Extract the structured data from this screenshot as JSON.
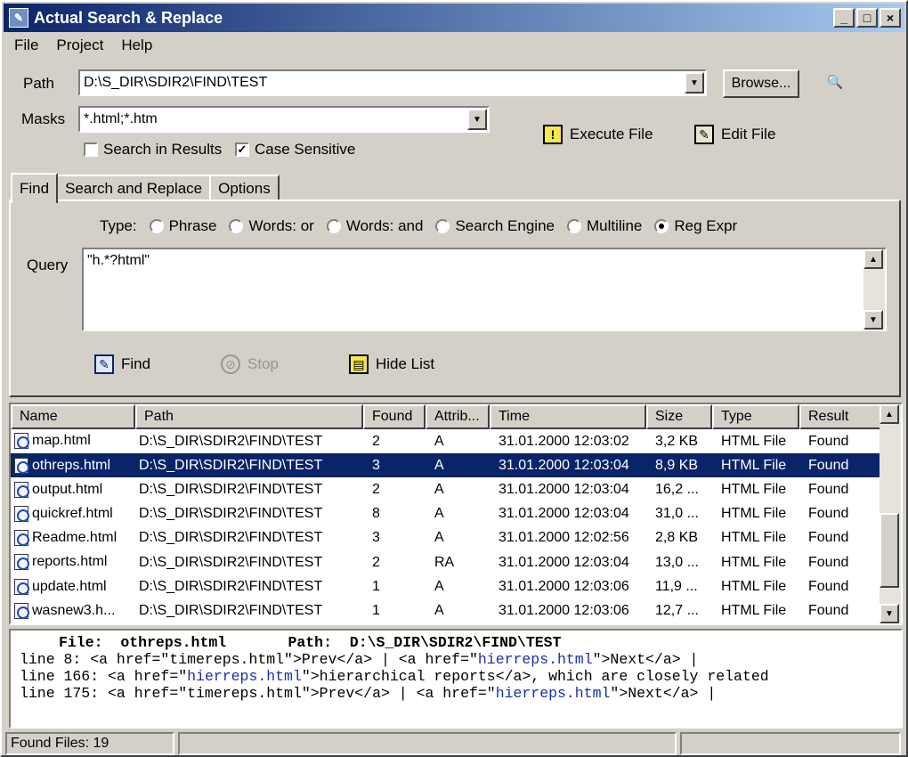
{
  "window": {
    "title": "Actual Search & Replace",
    "minimize": "_",
    "maximize": "□",
    "close": "×"
  },
  "menu": [
    "File",
    "Project",
    "Help"
  ],
  "path": {
    "label": "Path",
    "value": "D:\\S_DIR\\SDIR2\\FIND\\TEST",
    "browse_label": "Browse..."
  },
  "masks": {
    "label": "Masks",
    "value": "*.html;*.htm"
  },
  "options": {
    "search_in_results": "Search in Results",
    "search_in_results_checked": false,
    "case_sensitive": "Case Sensitive",
    "case_sensitive_checked": true
  },
  "actions": {
    "execute_file": "Execute File",
    "edit_file": "Edit File"
  },
  "tabs": [
    {
      "label": "Find",
      "active": true
    },
    {
      "label": "Search and Replace",
      "active": false
    },
    {
      "label": "Options",
      "active": false
    }
  ],
  "find": {
    "type_label": "Type:",
    "types": [
      {
        "label": "Phrase",
        "selected": false
      },
      {
        "label": "Words: or",
        "selected": false
      },
      {
        "label": "Words: and",
        "selected": false
      },
      {
        "label": "Search Engine",
        "selected": false
      },
      {
        "label": "Multiline",
        "selected": false
      },
      {
        "label": "Reg Expr",
        "selected": true
      }
    ],
    "query_label": "Query",
    "query": "\"h.*?html\"",
    "find_label": "Find",
    "stop_label": "Stop",
    "hide_list_label": "Hide List"
  },
  "table": {
    "columns": [
      "Name",
      "Path",
      "Found",
      "Attrib...",
      "Time",
      "Size",
      "Type",
      "Result"
    ],
    "rows": [
      [
        "map.html",
        "D:\\S_DIR\\SDIR2\\FIND\\TEST",
        "2",
        "A",
        "31.01.2000 12:03:02",
        "3,2 KB",
        "HTML File",
        "Found"
      ],
      [
        "othreps.html",
        "D:\\S_DIR\\SDIR2\\FIND\\TEST",
        "3",
        "A",
        "31.01.2000 12:03:04",
        "8,9 KB",
        "HTML File",
        "Found"
      ],
      [
        "output.html",
        "D:\\S_DIR\\SDIR2\\FIND\\TEST",
        "2",
        "A",
        "31.01.2000 12:03:04",
        "16,2 ...",
        "HTML File",
        "Found"
      ],
      [
        "quickref.html",
        "D:\\S_DIR\\SDIR2\\FIND\\TEST",
        "8",
        "A",
        "31.01.2000 12:03:04",
        "31,0 ...",
        "HTML File",
        "Found"
      ],
      [
        "Readme.html",
        "D:\\S_DIR\\SDIR2\\FIND\\TEST",
        "3",
        "A",
        "31.01.2000 12:02:56",
        "2,8 KB",
        "HTML File",
        "Found"
      ],
      [
        "reports.html",
        "D:\\S_DIR\\SDIR2\\FIND\\TEST",
        "2",
        "RA",
        "31.01.2000 12:03:04",
        "13,0 ...",
        "HTML File",
        "Found"
      ],
      [
        "update.html",
        "D:\\S_DIR\\SDIR2\\FIND\\TEST",
        "1",
        "A",
        "31.01.2000 12:03:06",
        "11,9 ...",
        "HTML File",
        "Found"
      ],
      [
        "wasnew3.h...",
        "D:\\S_DIR\\SDIR2\\FIND\\TEST",
        "1",
        "A",
        "31.01.2000 12:03:06",
        "12,7 ...",
        "HTML File",
        "Found"
      ]
    ],
    "selected_row": 1
  },
  "preview": {
    "file_label": "File:",
    "file": "othreps.html",
    "path_label": "Path:",
    "path": "D:\\S_DIR\\SDIR2\\FIND\\TEST",
    "lines": [
      {
        "prefix": "line 8: <a href=\"timereps.html\">Prev</a> | <a href=\"",
        "link": "hierreps.html",
        "suffix": "\">Next</a> |"
      },
      {
        "prefix": "line 166: <a href=\"",
        "link": "hierreps.html",
        "suffix": "\">hierarchical reports</a>, which are closely related"
      },
      {
        "prefix": "line 175: <a href=\"timereps.html\">Prev</a> | <a href=\"",
        "link": "hierreps.html",
        "suffix": "\">Next</a> |"
      }
    ]
  },
  "status": {
    "found_files": "Found Files:  19"
  },
  "colors": {
    "titlebar": "#0a246a",
    "selection": "#0a246a",
    "link": "#1c2fa8",
    "face": "#d4d0c8"
  }
}
